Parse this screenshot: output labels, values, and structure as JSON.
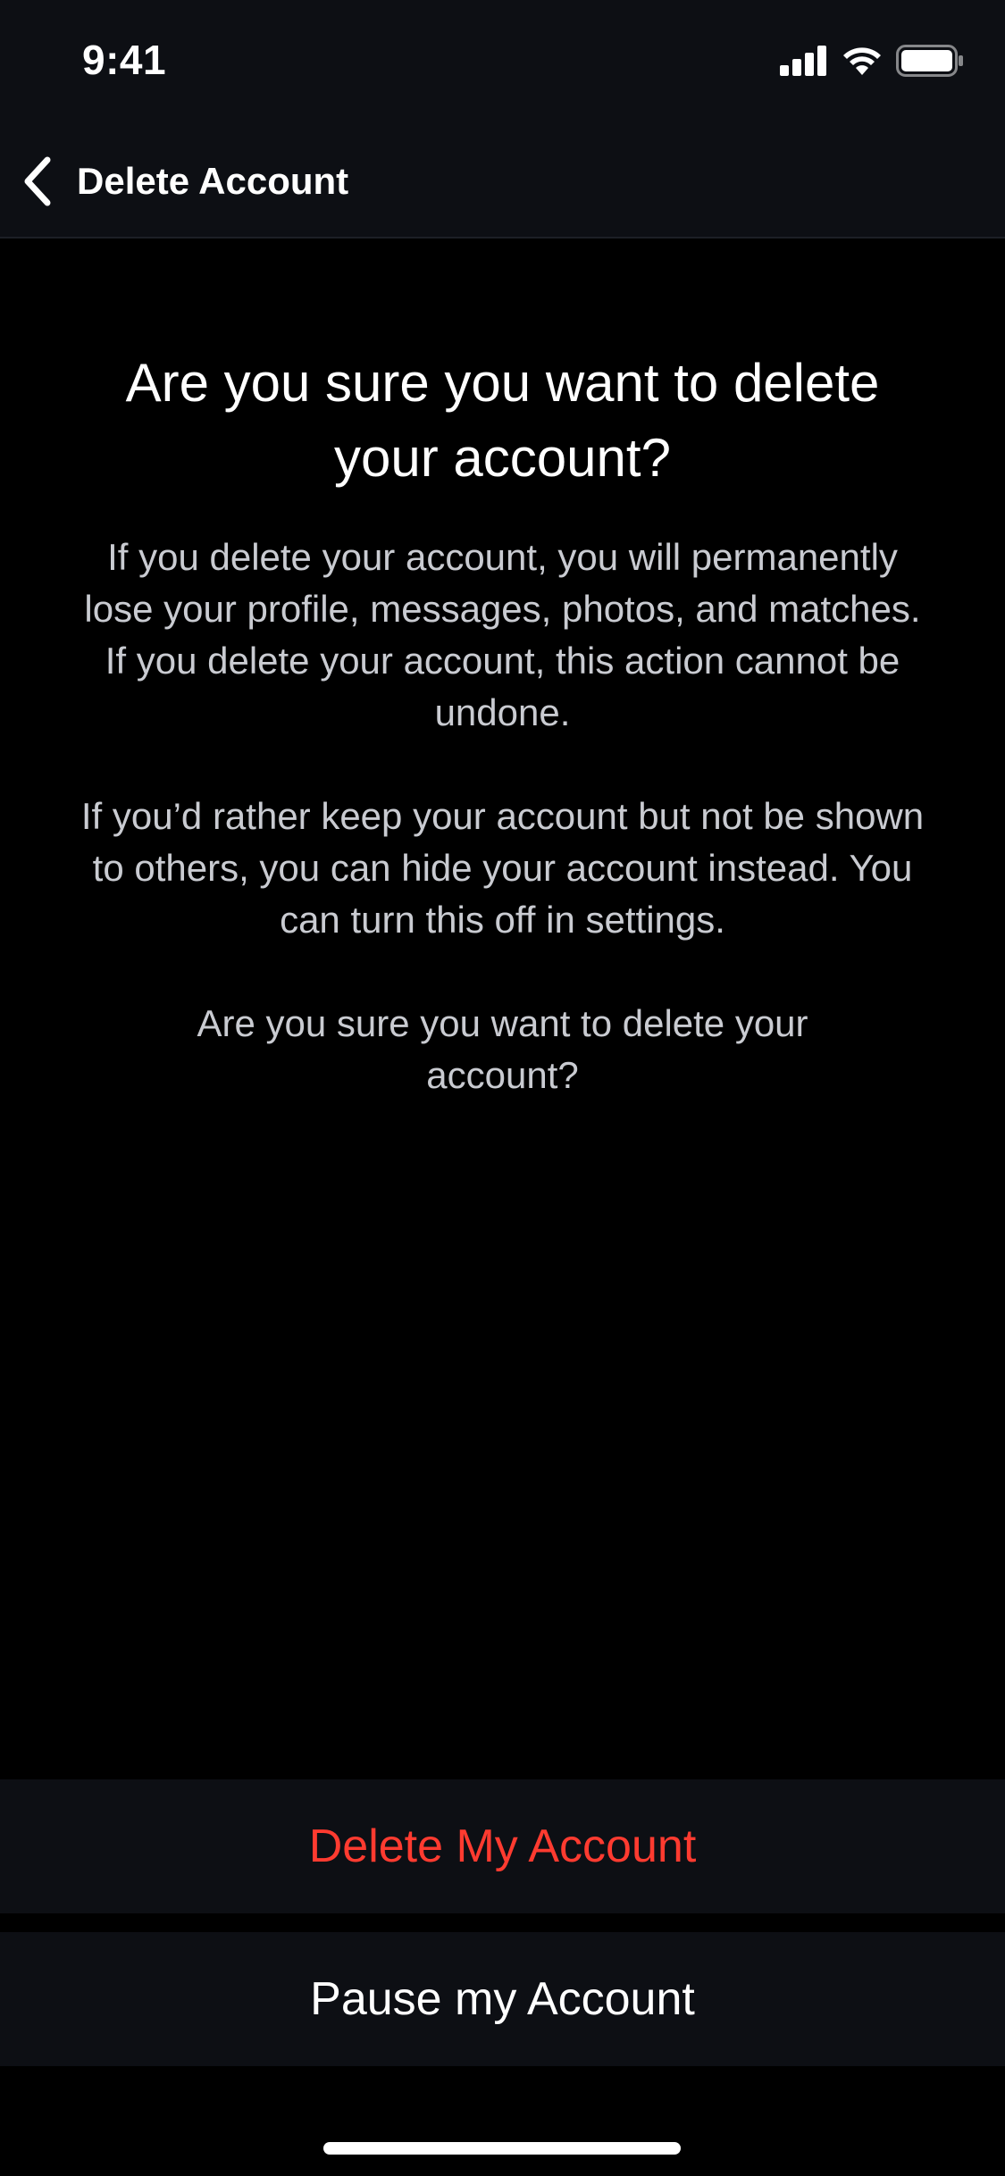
{
  "status_bar": {
    "time": "9:41",
    "icons": [
      "cellular-signal-icon",
      "wifi-icon",
      "battery-icon"
    ]
  },
  "nav": {
    "back_icon": "chevron-left-icon",
    "title": "Delete Account"
  },
  "content": {
    "headline": "Are you sure you want to delete your account?",
    "paragraph_1": "If you delete your account, you will permanently lose your profile, messages, photos, and matches. If you delete your account, this action cannot be undone.",
    "paragraph_2": "If you’d rather keep your account but not be shown to others, you can hide your account instead. You can turn this off in settings.",
    "paragraph_3": "Are you sure you want to delete your account?"
  },
  "actions": {
    "delete_label": "Delete My Account",
    "pause_label": "Pause my Account"
  },
  "colors": {
    "background": "#000000",
    "bar_background": "#0d0f14",
    "destructive": "#ff3b30",
    "body_text": "#c9cbd1"
  }
}
